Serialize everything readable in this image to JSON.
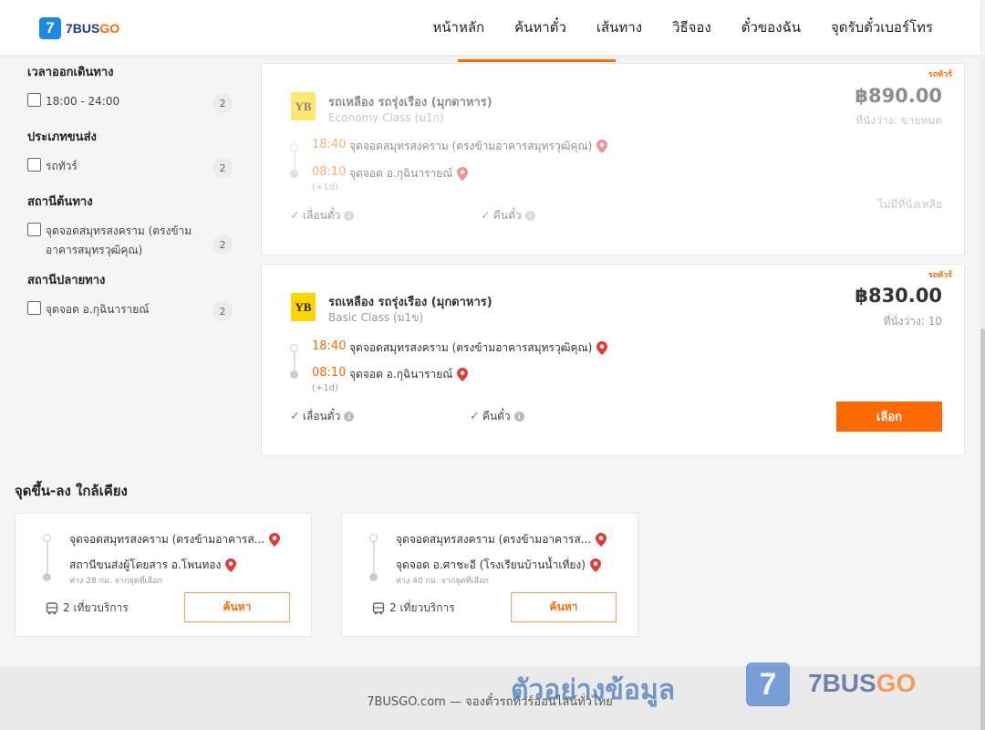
{
  "brand": {
    "prefix": "7BUS",
    "suffix": "GO",
    "logo_glyph": "7",
    "accent": "#ff6a00",
    "brand_blue": "#1e3a8a"
  },
  "nav": [
    {
      "label": "หน้าหลัก"
    },
    {
      "label": "ค้นหาตั๋ว"
    },
    {
      "label": "เส้นทาง"
    },
    {
      "label": "วิธีจอง"
    },
    {
      "label": "ตั๋วของฉัน"
    },
    {
      "label": "จุดรับตั๋วเบอร์โทร"
    }
  ],
  "filters": [
    {
      "title": "เวลาออกเดินทาง",
      "options": [
        {
          "label": "18:00 - 24:00",
          "count": "2"
        }
      ]
    },
    {
      "title": "ประเภทขนส่ง",
      "options": [
        {
          "label": "รถทัวร์",
          "count": "2"
        }
      ]
    },
    {
      "title": "สถานีต้นทาง",
      "options": [
        {
          "label": "จุดจอดสมุทรสงคราม (ตรงข้ามอาคารสมุทรวุฒิคุณ)",
          "count": "2"
        }
      ]
    },
    {
      "title": "สถานีปลายทาง",
      "options": [
        {
          "label": "จุดจอด อ.กุฉินารายณ์",
          "count": "2"
        }
      ]
    }
  ],
  "trips": [
    {
      "badge": "รถทัวร์",
      "operator_logo": "YB",
      "operator": "รถเหลือง รถรุ่งเรือง (มุกดาหาร)",
      "class": "Economy Class (ม1ก)",
      "price": "฿890.00",
      "seats": "ที่นั่งว่าง: ขายหมด",
      "depart_time": "18:40",
      "depart_stop": "จุดจอดสมุทรสงคราม (ตรงข้ามอาคารสมุทรวุฒิคุณ)",
      "arrive_time": "08:10",
      "arrive_stop": "จุดจอด อ.กุฉินารายณ์",
      "day_offset": "(+1d)",
      "feature1": "เลื่อนตั๋ว",
      "feature2": "คืนตั๋ว",
      "status": "ไม่มีที่นั่งเหลือ"
    },
    {
      "badge": "รถทัวร์",
      "operator_logo": "YB",
      "operator": "รถเหลือง รถรุ่งเรือง (มุกดาหาร)",
      "class": "Basic Class (ม1ข)",
      "price": "฿830.00",
      "seats": "ที่นั่งว่าง: 10",
      "depart_time": "18:40",
      "depart_stop": "จุดจอดสมุทรสงคราม (ตรงข้ามอาคารสมุทรวุฒิคุณ)",
      "arrive_time": "08:10",
      "arrive_stop": "จุดจอด อ.กุฉินารายณ์",
      "day_offset": "(+1d)",
      "feature1": "เลื่อนตั๋ว",
      "feature2": "คืนตั๋ว",
      "select_label": "เลือก"
    }
  ],
  "nearby": {
    "title": "จุดขึ้น-ลง ใกล้เคียง",
    "items": [
      {
        "from": "จุดจอดสมุทรสงคราม (ตรงข้ามอาคารส...",
        "to": "สถานีขนส่งผู้โดยสาร อ.โพนทอง",
        "distance": "ห่าง 28 กม. จากจุดที่เลือก",
        "trips": "2 เที่ยวบริการ",
        "button": "ค้นหา"
      },
      {
        "from": "จุดจอดสมุทรสงคราม (ตรงข้ามอาคารส...",
        "to": "จุดจอด อ.ศาชะอี (โรงเรียนบ้านน้ำเที่ยง)",
        "distance": "ห่าง 40 กม. จากจุดที่เลือก",
        "trips": "2 เที่ยวบริการ",
        "button": "ค้นหา"
      }
    ]
  },
  "footer": {
    "text": "7BUSGO.com — จองตั๋วรถทัวร์ออนไลน์ทั่วไทย"
  },
  "watermark": {
    "text": "ตัวอย่างข้อมูล",
    "logo_glyph": "7",
    "brand_prefix": "7BUS",
    "brand_suffix": "GO"
  }
}
